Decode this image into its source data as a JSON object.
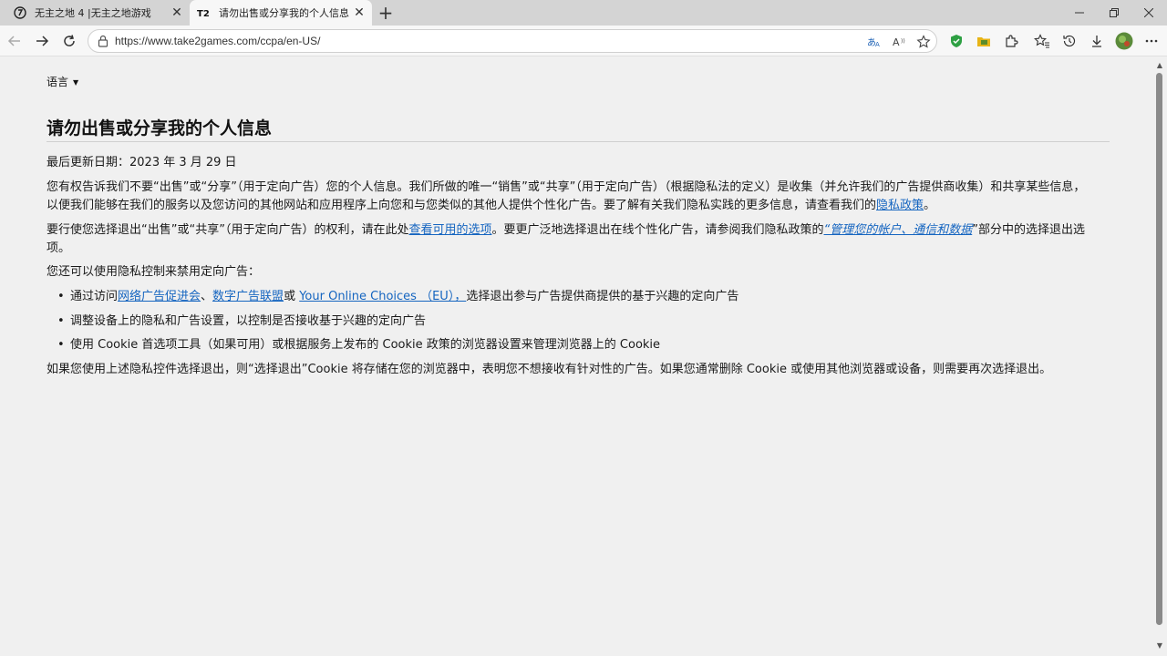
{
  "tabs": [
    {
      "title": "无主之地 4 |无主之地游戏",
      "icon": "take-two-circle-icon"
    },
    {
      "title": "请勿出售或分享我的个人信息",
      "icon": "t2-logo-icon"
    }
  ],
  "address_bar": {
    "url": "https://www.take2games.com/ccpa/en-US/"
  },
  "page": {
    "language_label": "语言",
    "heading": "请勿出售或分享我的个人信息",
    "updated": "最后更新日期：2023 年 3 月 29 日",
    "p1_line1": "您有权告诉我们不要“出售”或“分享”（用于定向广告）您的个人信息。我们所做的唯一“销售”或“共享”（用于定向广告）（根据隐私法的定义）是收集（并允许我们的广告提供商收集）和共享某些信息，",
    "p1_line2": "以便我们能够在我们的服务以及您访问的其他网站和应用程序上向您和与您类似的其他人提供个性化广告。要了解有关我们隐私实践的更多信息，请查看我们的",
    "p1_link": "隐私政策",
    "p1_end": "。",
    "p2_pre": "要行使您选择退出“出售”或“共享”（用于定向广告）的权利，请在此处",
    "p2_link1": "查看可用的选项",
    "p2_mid": "。要更广泛地选择退出在线个性化广告，请参阅我们隐私政策的",
    "p2_link2": "“管理您的帐户、通信和数据",
    "p2_post": "”部分中的选择退出选",
    "p2_line2": "项。",
    "p3": "您还可以使用隐私控制来禁用定向广告：",
    "bullet1_pre": "通过访问",
    "bullet1_link1": "网络广告促进会",
    "bullet1_sep1": "、",
    "bullet1_link2": "数字广告联盟",
    "bullet1_sep2": "或 ",
    "bullet1_link3": "Your Online Choices （EU），",
    "bullet1_post": "选择退出参与广告提供商提供的基于兴趣的定向广告",
    "bullet2": "调整设备上的隐私和广告设置，以控制是否接收基于兴趣的定向广告",
    "bullet3": "使用 Cookie 首选项工具（如果可用）或根据服务上发布的 Cookie 政策的浏览器设置来管理浏览器上的 Cookie",
    "p4": "如果您使用上述隐私控件选择退出，则“选择退出”Cookie 将存储在您的浏览器中，表明您不想接收有针对性的广告。如果您通常删除 Cookie 或使用其他浏览器或设备，则需要再次选择退出。"
  }
}
